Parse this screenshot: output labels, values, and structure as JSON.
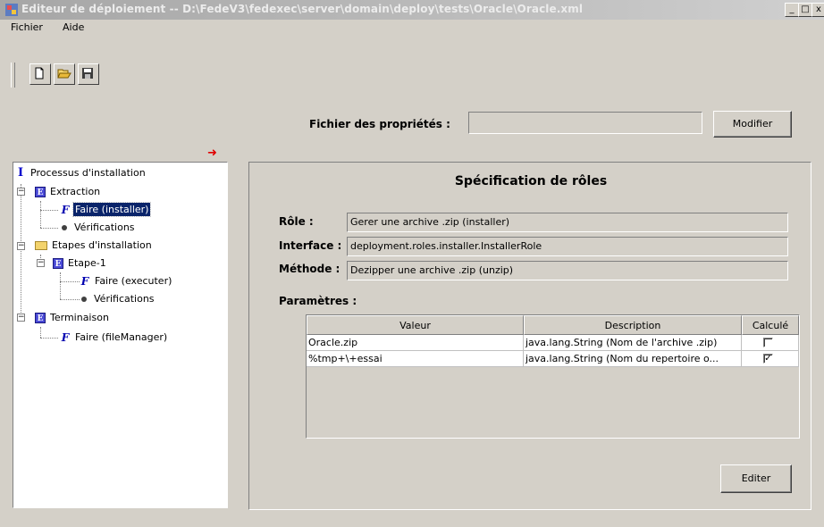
{
  "window": {
    "title": "Editeur de déploiement -- D:\\FedeV3\\fedexec\\server\\domain\\deploy\\tests\\Oracle\\Oracle.xml",
    "buttons": {
      "minimize": "_",
      "maximize": "□",
      "close": "x"
    }
  },
  "menu": {
    "file": "Fichier",
    "help": "Aide"
  },
  "toolbar": {
    "icons": [
      "new-file-icon",
      "open-folder-icon",
      "save-icon"
    ]
  },
  "properties": {
    "label": "Fichier des propriétés :",
    "value": "",
    "modify_button": "Modifier"
  },
  "tree": {
    "root": {
      "badge": "I",
      "label": "Processus d'installation"
    },
    "extraction": {
      "badge": "E",
      "label": "Extraction"
    },
    "faire_installer": {
      "badge": "F",
      "label": "Faire (installer)"
    },
    "verif1": {
      "label": "Vérifications"
    },
    "etapes": {
      "label": "Etapes d'installation"
    },
    "etape1": {
      "badge": "E",
      "label": "Etape-1"
    },
    "faire_executer": {
      "badge": "F",
      "label": "Faire (executer)"
    },
    "verif2": {
      "label": "Vérifications"
    },
    "terminaison": {
      "badge": "E",
      "label": "Terminaison"
    },
    "faire_filemanager": {
      "badge": "F",
      "label": "Faire (fileManager)"
    },
    "expander_minus": "−"
  },
  "spec": {
    "title": "Spécification de rôles",
    "role_label": "Rôle :",
    "role_value": "Gerer une archive .zip (installer)",
    "interface_label": "Interface :",
    "interface_value": "deployment.roles.installer.InstallerRole",
    "method_label": "Méthode :",
    "method_value": "Dezipper une archive .zip (unzip)",
    "params_label": "Paramètres :",
    "edit_button": "Editer"
  },
  "params_table": {
    "headers": [
      "Valeur",
      "Description",
      "Calculé"
    ],
    "rows": [
      {
        "value": "Oracle.zip",
        "description": "java.lang.String (Nom de l'archive .zip)",
        "computed": false,
        "check": ""
      },
      {
        "value": "%tmp+\\+essai",
        "description": "java.lang.String (Nom du repertoire o...",
        "computed": true,
        "check": "✓"
      }
    ]
  },
  "colors": {
    "window_bg": "#d4d0c8",
    "selection": "#0a246a",
    "tree_badge": "#4a4ad6"
  }
}
